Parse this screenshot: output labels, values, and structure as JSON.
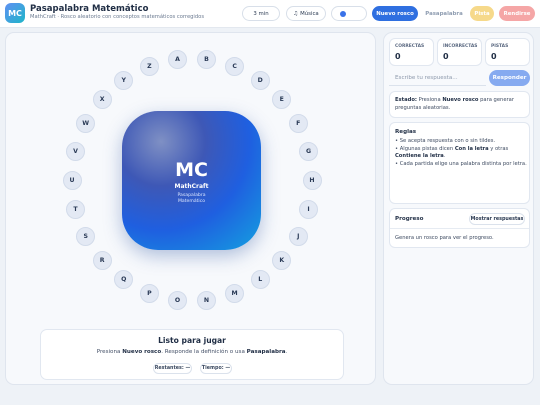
{
  "app": {
    "logo_text": "MC",
    "title": "Pasapalabra Matemático",
    "subtitle": "MathCraft · Rosco aleatorio con conceptos matemáticos corregidos"
  },
  "toolbar": {
    "time_label": "3 min",
    "music_icon": "music-note-icon",
    "music_label": "Música",
    "music_toggle_on": true,
    "new_label": "Nuevo rosco",
    "pass_label": "Pasapalabra",
    "hint_label": "Pista",
    "quit_label": "Rendirse"
  },
  "rosco": {
    "letters": [
      "A",
      "B",
      "C",
      "D",
      "E",
      "F",
      "G",
      "H",
      "I",
      "J",
      "K",
      "L",
      "M",
      "N",
      "O",
      "P",
      "Q",
      "R",
      "S",
      "T",
      "U",
      "V",
      "W",
      "X",
      "Y",
      "Z"
    ]
  },
  "center": {
    "initials": "MC",
    "name": "MathCraft",
    "sub_line1": "Pasapalabra",
    "sub_line2": "Matemático"
  },
  "status": {
    "title": "Listo para jugar",
    "text_prefix": "Presiona ",
    "text_new": "Nuevo rosco",
    "text_middle": ". Responde la definición o usa ",
    "text_pass": "Pasapalabra",
    "text_end": ".",
    "remaining_label": "Restantes: —",
    "time_label": "Tiempo: —"
  },
  "scores": [
    {
      "label": "CORRECTAS",
      "value": "0"
    },
    {
      "label": "INCORRECTAS",
      "value": "0"
    },
    {
      "label": "PISTAS",
      "value": "0"
    }
  ],
  "answer": {
    "placeholder": "Escribe tu respuesta...",
    "button_label": "Responder"
  },
  "estado": {
    "label": "Estado:",
    "text_a": " Presiona ",
    "text_b": "Nuevo rosco",
    "text_c": " para generar preguntas aleatorias."
  },
  "reglas": {
    "title": "Reglas",
    "rule1": "• Se acepta respuesta con o sin tildes.",
    "rule2_a": "• Algunas pistas dicen ",
    "rule2_b": "Con la letra",
    "rule2_c": " y otras ",
    "rule2_d": "Contiene la letra",
    "rule2_e": ".",
    "rule3": "• Cada partida elige una palabra distinta por letra."
  },
  "progreso": {
    "title": "Progreso",
    "button_label": "Mostrar respuestas",
    "text": "Genera un rosco para ver el progreso."
  }
}
